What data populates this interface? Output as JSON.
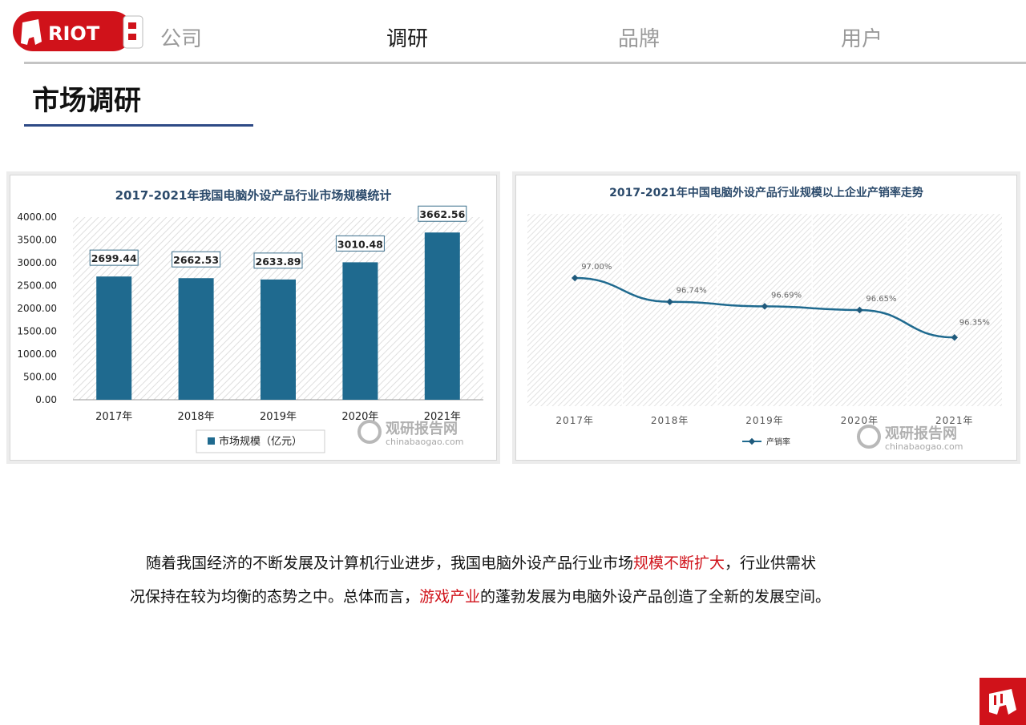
{
  "header": {
    "logo_text": "RIOT",
    "nav": [
      {
        "label": "公司",
        "active": false
      },
      {
        "label": "调研",
        "active": true
      },
      {
        "label": "品牌",
        "active": false
      },
      {
        "label": "用户",
        "active": false
      }
    ]
  },
  "page_title": "市场调研",
  "colors": {
    "accent_red": "#d0121a",
    "bar_blue": "#1f6a8f",
    "rule_blue": "#2e4a86"
  },
  "chart_data": [
    {
      "type": "bar",
      "title": "2017-2021年我国电脑外设产品行业市场规模统计",
      "categories": [
        "2017年",
        "2018年",
        "2019年",
        "2020年",
        "2021年"
      ],
      "series": [
        {
          "name": "市场规模（亿元）",
          "values": [
            2699.44,
            2662.53,
            2633.89,
            3010.48,
            3662.56
          ]
        }
      ],
      "value_labels": [
        "2699.44",
        "2662.53",
        "2633.89",
        "3010.48",
        "3662.56"
      ],
      "y_ticks": [
        "0.00",
        "500.00",
        "1000.00",
        "1500.00",
        "2000.00",
        "2500.00",
        "3000.00",
        "3500.00",
        "4000.00"
      ],
      "ylim": [
        0,
        4000
      ],
      "legend": "bottom",
      "watermark": {
        "name": "观研报告网",
        "url": "chinabaogao.com"
      }
    },
    {
      "type": "line",
      "title": "2017-2021年中国电脑外设产品行业规模以上企业产销率走势",
      "categories": [
        "2017年",
        "2018年",
        "2019年",
        "2020年",
        "2021年"
      ],
      "series": [
        {
          "name": "产销率",
          "values": [
            97.0,
            96.74,
            96.69,
            96.65,
            96.35
          ]
        }
      ],
      "value_labels": [
        "97.00%",
        "96.74%",
        "96.69%",
        "96.65%",
        "96.35%"
      ],
      "ylim": [
        95.6,
        97.7
      ],
      "legend": "bottom",
      "watermark": {
        "name": "观研报告网",
        "url": "chinabaogao.com"
      }
    }
  ],
  "paragraph": {
    "line1": {
      "pre": "随着我国经济的不断发展及计算机行业进步，我国电脑外设产品行业市场",
      "hl": "规模不断扩大",
      "post": "，行业供需状"
    },
    "line2": {
      "pre": "况保持在较为均衡的态势之中。总体而言，",
      "hl": "游戏产业",
      "post": "的蓬勃发展为电脑外设产品创造了全新的发展空间。"
    }
  }
}
